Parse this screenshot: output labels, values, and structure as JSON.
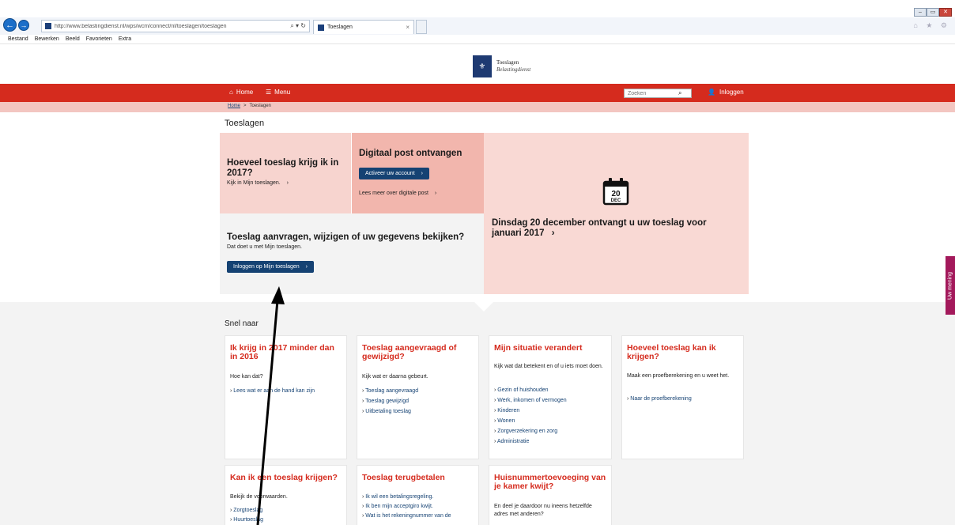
{
  "browser": {
    "url": "http://www.belastingdienst.nl/wps/wcm/connect/nl/toeslagen/toeslagen",
    "address_tools": "⌕ ▾ ↻",
    "tab_title": "Toeslagen",
    "tab_close": "×",
    "menu": [
      "Bestand",
      "Bewerken",
      "Beeld",
      "Favorieten",
      "Extra"
    ],
    "win_min": "‒",
    "win_max": "▭",
    "win_close": "✕",
    "right_icons": "⌂ ★ ⚙"
  },
  "logo": {
    "mark": "⚜",
    "line1": "Toeslagen",
    "line2": "Belastingdienst"
  },
  "nav": {
    "home_icon": "⌂",
    "home": "Home",
    "menu_icon": "☰",
    "menu": "Menu",
    "search_placeholder": "Zoeken",
    "search_icon": "⌕",
    "login_icon": "👤",
    "login": "Inloggen"
  },
  "breadcrumb": {
    "home": "Home",
    "sep": ">",
    "current": "Toeslagen"
  },
  "page_title": "Toeslagen",
  "tiles": {
    "hoeveel": {
      "title": "Hoeveel toeslag krijg ik in 2017?",
      "link": "Kijk in Mijn toeslagen.",
      "link_arrow": "›"
    },
    "digitaal": {
      "title": "Digitaal post ontvangen",
      "button": "Activeer uw account",
      "button_arrow": "›",
      "link": "Lees meer over digitale post",
      "link_arrow": "›"
    },
    "datum": {
      "cal_day": "20",
      "cal_month": "DEC",
      "title": "Dinsdag 20 december ontvangt u uw toeslag voor januari 2017",
      "arrow": "›"
    },
    "aanvragen": {
      "title": "Toeslag aanvragen, wijzigen of uw gegevens bekijken?",
      "sub": "Dat doet u met Mijn toeslagen.",
      "button": "Inloggen op Mijn toeslagen",
      "button_arrow": "›"
    }
  },
  "snel_naar": "Snel naar",
  "cards": [
    {
      "title": "Ik krijg in 2017 minder dan in 2016",
      "intro": "Hoe kan dat?",
      "links": [
        "Lees wat er aan de hand kan zijn"
      ]
    },
    {
      "title": "Toeslag aangevraagd of gewijzigd?",
      "intro": "Kijk wat er daarna gebeurt.",
      "links": [
        "Toeslag aangevraagd",
        "Toeslag gewijzigd",
        "Uitbetaling toeslag"
      ]
    },
    {
      "title": "Mijn situatie verandert",
      "intro": "Kijk wat dat betekent en of u iets moet doen.",
      "links": [
        "Gezin of huishouden",
        "Werk, inkomen of vermogen",
        "Kinderen",
        "Wonen",
        "Zorgverzekering en zorg",
        "Administratie"
      ]
    },
    {
      "title": "Hoeveel toeslag kan ik krijgen?",
      "intro": "Maak een proefberekening en u weet het.",
      "links": [
        "Naar de proefberekening"
      ]
    },
    {
      "title": "Kan ik een toeslag krijgen?",
      "intro": "Bekijk de voorwaarden.",
      "links": [
        "Zorgtoeslag",
        "Huurtoeslag"
      ]
    },
    {
      "title": "Toeslag terugbetalen",
      "intro": "",
      "links": [
        "Ik wil een betalingsregeling.",
        "Ik ben mijn acceptgiro kwijt.",
        "Wat is het rekeningnummer van de"
      ]
    },
    {
      "title": "Huisnummertoevoeging van je kamer kwijt?",
      "intro": "En deel je daardoor nu ineens hetzelfde adres met anderen?",
      "links": []
    }
  ],
  "feedback_tab": "Uw mening"
}
